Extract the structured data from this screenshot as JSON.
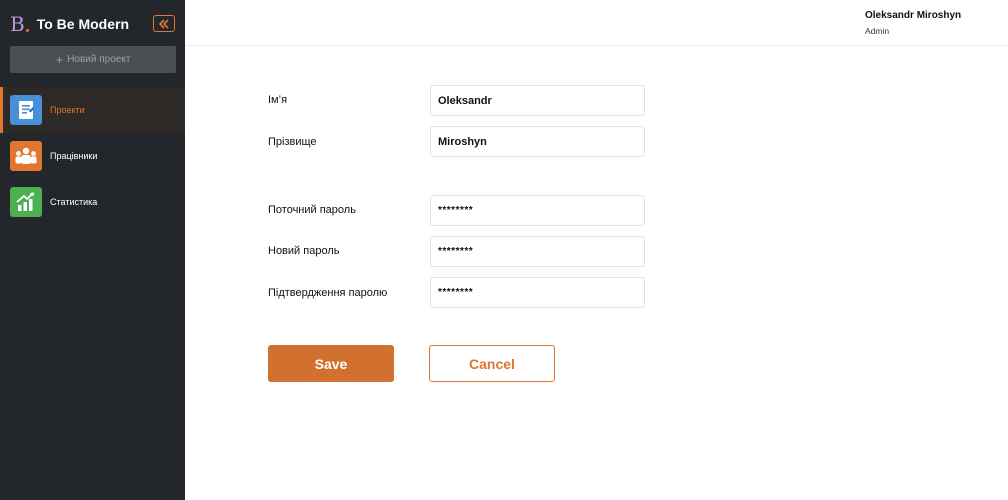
{
  "brand": {
    "logo_letter": "B",
    "title": "To Be Modern"
  },
  "sidebar": {
    "new_project_label": "Новий проект",
    "items": [
      {
        "label": "Проекти",
        "icon": "document-icon",
        "color": "#4a90d9",
        "active": true
      },
      {
        "label": "Працівники",
        "icon": "team-icon",
        "color": "#e2762e",
        "active": false
      },
      {
        "label": "Статистика",
        "icon": "chart-icon",
        "color": "#4caf50",
        "active": false
      }
    ]
  },
  "header": {
    "user_name": "Oleksandr Miroshyn",
    "user_role": "Admin"
  },
  "form": {
    "first_name": {
      "label": "Ім’я",
      "value": "Oleksandr"
    },
    "last_name": {
      "label": "Прізвище",
      "value": "Miroshyn"
    },
    "current_password": {
      "label": "Поточний пароль",
      "value": "********"
    },
    "new_password": {
      "label": "Новий пароль",
      "value": "********"
    },
    "confirm_password": {
      "label": "Підтвердження паролю",
      "value": "********"
    }
  },
  "actions": {
    "save_label": "Save",
    "cancel_label": "Cancel"
  },
  "colors": {
    "accent": "#e2762e",
    "sidebar_bg": "#23272b"
  }
}
